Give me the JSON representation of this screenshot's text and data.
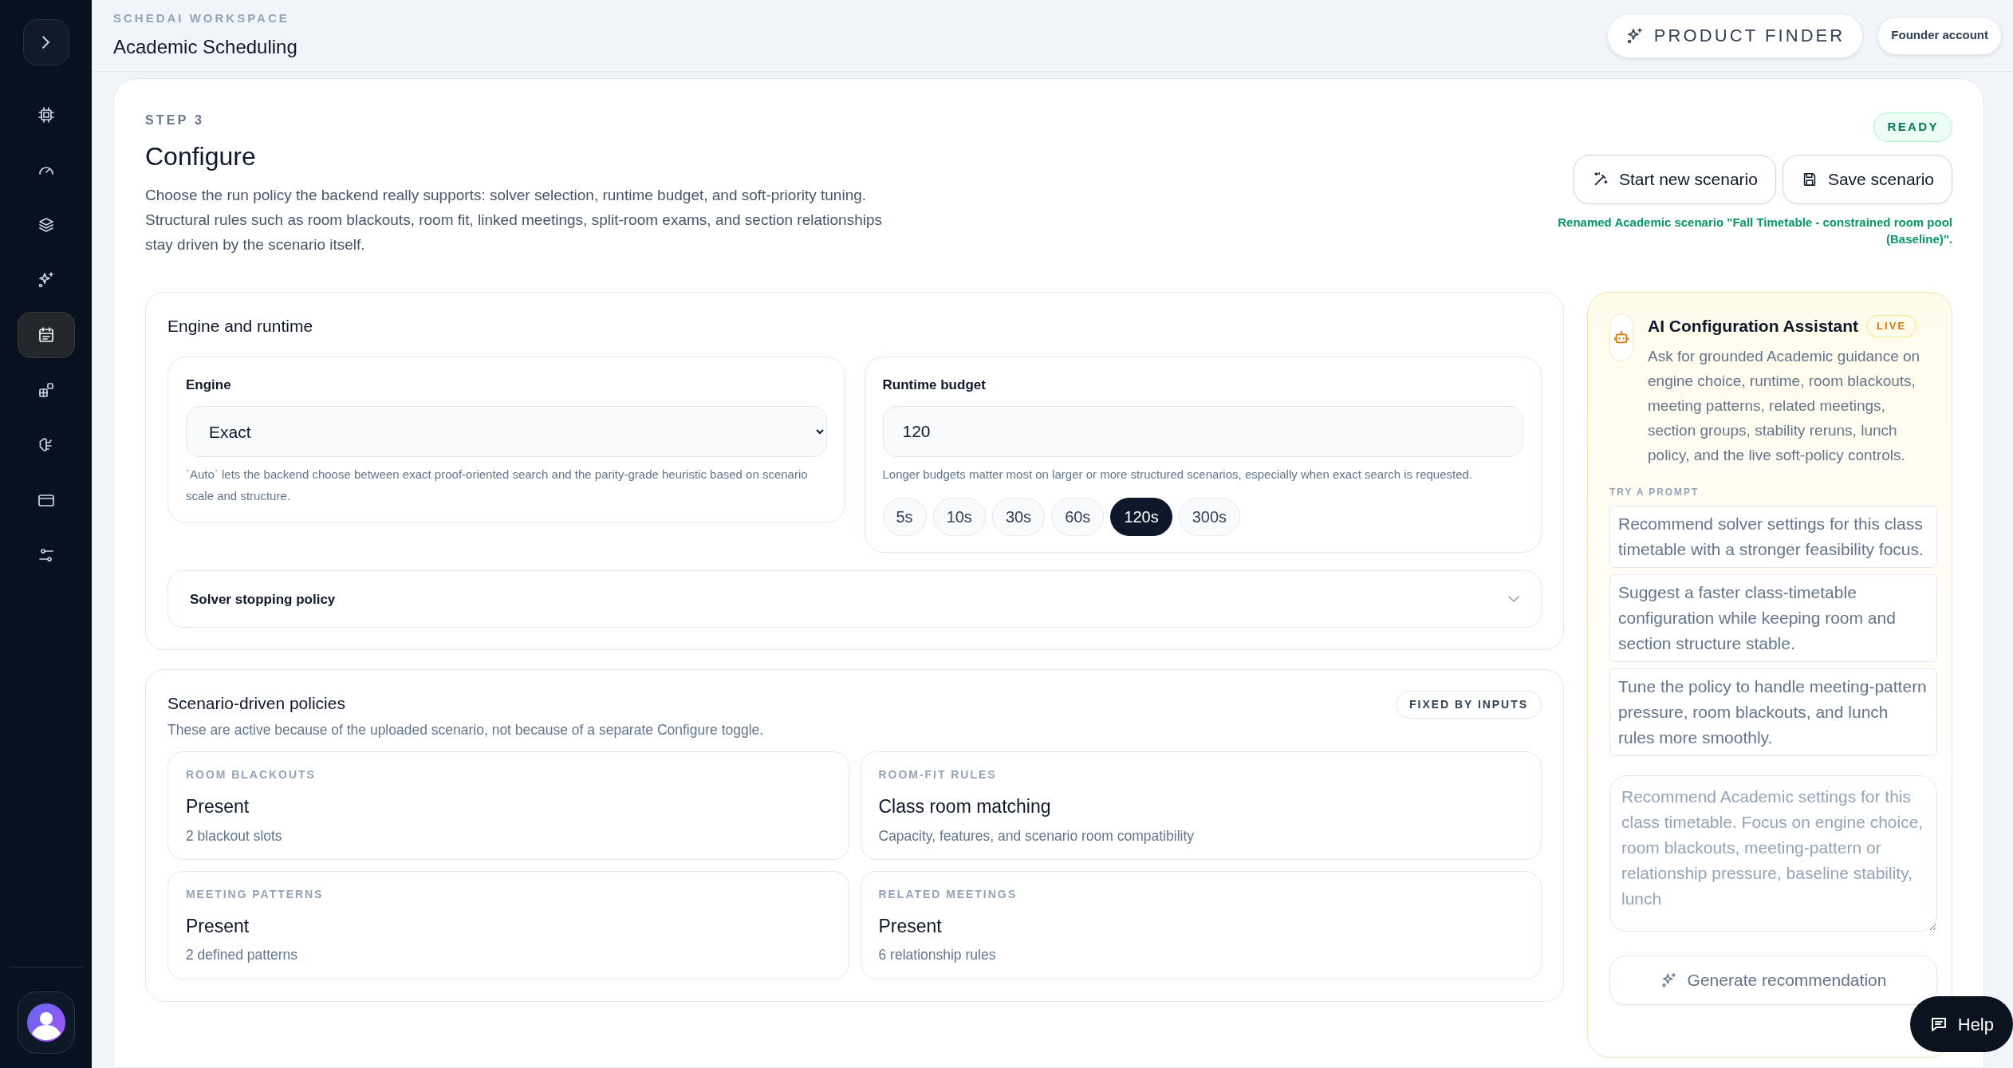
{
  "sidebar": {
    "items": [
      {
        "selected": false
      },
      {
        "selected": false
      },
      {
        "selected": false
      },
      {
        "selected": false
      },
      {
        "selected": true
      },
      {
        "selected": false
      },
      {
        "selected": false
      },
      {
        "selected": false
      },
      {
        "selected": false
      }
    ]
  },
  "header": {
    "eyebrow": "SCHEDAI WORKSPACE",
    "title": "Academic Scheduling",
    "product_finder": "PRODUCT FINDER",
    "account": "Founder account"
  },
  "step": {
    "eyebrow": "STEP 3",
    "title": "Configure",
    "description": "Choose the run policy the backend really supports: solver selection, runtime budget, and soft-priority tuning. Structural rules such as room blackouts, room fit, linked meetings, split-room exams, and section relationships stay driven by the scenario itself.",
    "status": "READY",
    "buttons": [
      {
        "label": "Start new scenario",
        "kind": "new"
      },
      {
        "label": "Save scenario",
        "kind": "save"
      }
    ],
    "message": "Renamed Academic scenario \"Fall Timetable - constrained room pool (Baseline)\"."
  },
  "engine_runtime": {
    "title": "Engine and runtime",
    "engine": {
      "label": "Engine",
      "value": "Exact",
      "hint": "`Auto` lets the backend choose between exact proof-oriented search and the parity-grade heuristic based on scenario scale and structure."
    },
    "runtime": {
      "label": "Runtime budget",
      "value": "120",
      "hint": "Longer budgets matter most on larger or more structured scenarios, especially when exact search is requested.",
      "presets": [
        {
          "label": "5s",
          "selected": false
        },
        {
          "label": "10s",
          "selected": false
        },
        {
          "label": "30s",
          "selected": false
        },
        {
          "label": "60s",
          "selected": false
        },
        {
          "label": "120s",
          "selected": true
        },
        {
          "label": "300s",
          "selected": false
        }
      ]
    },
    "stopping_policy": {
      "label": "Solver stopping policy",
      "expanded": false
    }
  },
  "policies": {
    "title": "Scenario-driven policies",
    "badge": "FIXED BY INPUTS",
    "subtitle": "These are active because of the uploaded scenario, not because of a separate Configure toggle.",
    "items": [
      {
        "eyebrow": "ROOM BLACKOUTS",
        "value": "Present",
        "detail": "2 blackout slots"
      },
      {
        "eyebrow": "ROOM-FIT RULES",
        "value": "Class room matching",
        "detail": "Capacity, features, and scenario room compatibility"
      },
      {
        "eyebrow": "MEETING PATTERNS",
        "value": "Present",
        "detail": "2 defined patterns"
      },
      {
        "eyebrow": "RELATED MEETINGS",
        "value": "Present",
        "detail": "6 relationship rules"
      }
    ]
  },
  "assistant": {
    "title": "AI Configuration Assistant",
    "badge": "LIVE",
    "description": "Ask for grounded Academic guidance on engine choice, runtime, room blackouts, meeting patterns, related meetings, section groups, stability reruns, lunch policy, and the live soft-policy controls.",
    "prompts_label": "TRY A PROMPT",
    "prompts": [
      "Recommend solver settings for this class timetable with a stronger feasibility focus.",
      "Suggest a faster class-timetable configuration while keeping room and section structure stable.",
      "Tune the policy to handle meeting-pattern pressure, room blackouts, and lunch rules more smoothly."
    ],
    "input": {
      "placeholder": "Recommend Academic settings for this class timetable. Focus on engine choice, room blackouts, meeting-pattern or relationship pressure, baseline stability, lunch"
    },
    "button": "Generate recommendation"
  },
  "help": {
    "label": "Help"
  }
}
